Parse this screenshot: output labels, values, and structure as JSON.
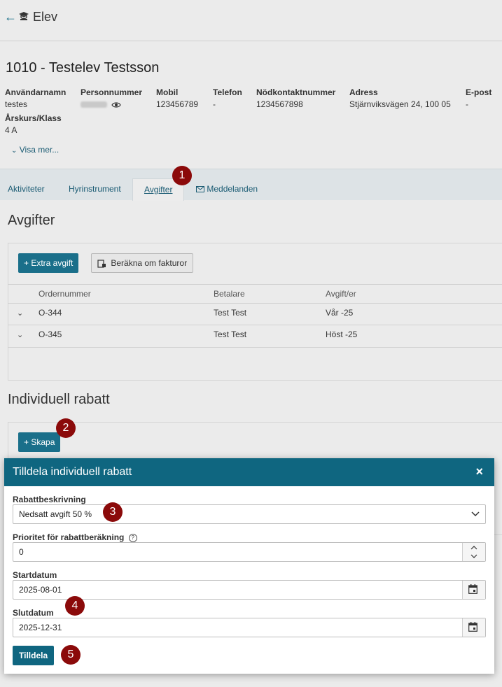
{
  "header": {
    "back_glyph": "←",
    "title": "Elev"
  },
  "student": {
    "title": "1010 - Testelev Testsson",
    "fields": {
      "username_label": "Användarnamn",
      "username": "testes",
      "personnummer_label": "Personnummer",
      "mobil_label": "Mobil",
      "mobil": "123456789",
      "telefon_label": "Telefon",
      "telefon": "-",
      "nodkontakt_label": "Nödkontaktnummer",
      "nodkontakt": "1234567898",
      "adress_label": "Adress",
      "adress": "Stjärnviksvägen 24, 100 05",
      "epost_label": "E-post",
      "epost": "-",
      "arskurs_label": "Årskurs/Klass",
      "arskurs": "4 A"
    },
    "show_more": "Visa mer..."
  },
  "tabs": [
    {
      "label": "Aktiviteter"
    },
    {
      "label": "Hyrinstrument"
    },
    {
      "label": "Avgifter"
    },
    {
      "label": "Meddelanden"
    }
  ],
  "avgifter": {
    "heading": "Avgifter",
    "extra_button": "+ Extra avgift",
    "recalc_button": "Beräkna om fakturor",
    "columns": [
      "Ordernummer",
      "Betalare",
      "Avgift/er"
    ],
    "rows": [
      {
        "order": "O-344",
        "payer": "Test Test",
        "fee": "Vår -25"
      },
      {
        "order": "O-345",
        "payer": "Test Test",
        "fee": "Höst -25"
      }
    ]
  },
  "rabatt": {
    "heading": "Individuell rabatt",
    "create_button": "+ Skapa"
  },
  "modal": {
    "title": "Tilldela individuell rabatt",
    "close": "×",
    "desc_label": "Rabattbeskrivning",
    "desc_value": "Nedsatt avgift 50 %",
    "priority_label": "Prioritet för rabattberäkning",
    "priority_value": "0",
    "start_label": "Startdatum",
    "start_value": "2025-08-01",
    "end_label": "Slutdatum",
    "end_value": "2025-12-31",
    "assign_button": "Tilldela"
  },
  "markers": [
    "1",
    "2",
    "3",
    "4",
    "5"
  ],
  "colors": {
    "accent": "#0f6680",
    "marker": "#8b0a0a"
  }
}
